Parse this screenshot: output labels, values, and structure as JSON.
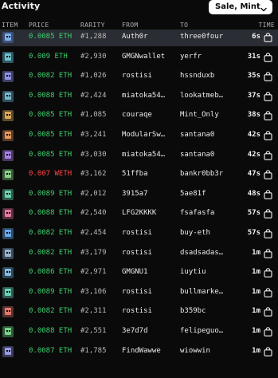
{
  "panel": {
    "title": "Activity",
    "filter_label": "Sale, Mint",
    "filter_icon": "chevron-down-icon"
  },
  "columns": {
    "item": "ITEM",
    "price": "PRICE",
    "rarity": "RARITY",
    "from": "FROM",
    "to": "TO",
    "time": "TIME"
  },
  "colors": {
    "background": "#0a0a0a",
    "highlight_row": "#2a2d33",
    "price_green": "#3ecf6e",
    "price_red": "#ff4545"
  },
  "rows": [
    {
      "price": "0.0085 ETH",
      "rarity": "#1,288",
      "from": "Auth0r",
      "to": "three0four",
      "time": "6s",
      "price_color": "green",
      "thumb_bg": "#3b4f7a",
      "thumb_face": "#7fb0e8",
      "highlight": true,
      "cart_icon": "shopping-bag-icon"
    },
    {
      "price": "0.009 ETH",
      "rarity": "#2,930",
      "from": "GMGNwallet",
      "to": "yerfr",
      "time": "31s",
      "price_color": "green",
      "thumb_bg": "#2f5a6a",
      "thumb_face": "#6fc2c9",
      "highlight": false,
      "cart_icon": "shopping-bag-icon"
    },
    {
      "price": "0.0082 ETH",
      "rarity": "#1,026",
      "from": "rostisi",
      "to": "hssnduxb",
      "time": "35s",
      "price_color": "green",
      "thumb_bg": "#3d3f66",
      "thumb_face": "#8e94e0",
      "highlight": false,
      "cart_icon": "shopping-bag-icon"
    },
    {
      "price": "0.0088 ETH",
      "rarity": "#2,424",
      "from": "miatoka54…",
      "to": "lookatmeb…",
      "time": "37s",
      "price_color": "green",
      "thumb_bg": "#2f4f5e",
      "thumb_face": "#78b6c8",
      "highlight": false,
      "cart_icon": "shopping-bag-icon"
    },
    {
      "price": "0.0085 ETH",
      "rarity": "#1,085",
      "from": "couraqe",
      "to": "Mint_Only",
      "time": "38s",
      "price_color": "green",
      "thumb_bg": "#5e4a2c",
      "thumb_face": "#d8a85c",
      "highlight": false,
      "cart_icon": "shopping-bag-icon"
    },
    {
      "price": "0.0085 ETH",
      "rarity": "#3,241",
      "from": "ModularSw…",
      "to": "santana0",
      "time": "42s",
      "price_color": "green",
      "thumb_bg": "#5a3a2a",
      "thumb_face": "#e09a5a",
      "highlight": false,
      "cart_icon": "shopping-bag-icon"
    },
    {
      "price": "0.0085 ETH",
      "rarity": "#3,030",
      "from": "miatoka54…",
      "to": "santana0",
      "time": "42s",
      "price_color": "green",
      "thumb_bg": "#4a3866",
      "thumb_face": "#a782df",
      "highlight": false,
      "cart_icon": "shopping-bag-icon"
    },
    {
      "price": "0.007 WETH",
      "rarity": "#3,162",
      "from": "51ffba",
      "to": "bankr0bb3r",
      "time": "47s",
      "price_color": "red",
      "thumb_bg": "#3a5a3a",
      "thumb_face": "#8ed08a",
      "highlight": false,
      "cart_icon": "shopping-bag-icon"
    },
    {
      "price": "0.0089 ETH",
      "rarity": "#2,012",
      "from": "3915a7",
      "to": "5ae81f",
      "time": "48s",
      "price_color": "green",
      "thumb_bg": "#2c5a4c",
      "thumb_face": "#6fd0b0",
      "highlight": false,
      "cart_icon": "shopping-bag-icon"
    },
    {
      "price": "0.0088 ETH",
      "rarity": "#2,540",
      "from": "LFG2KKKK",
      "to": "fsafasfa",
      "time": "57s",
      "price_color": "green",
      "thumb_bg": "#5a2f3f",
      "thumb_face": "#e07aa0",
      "highlight": false,
      "cart_icon": "shopping-bag-icon"
    },
    {
      "price": "0.0082 ETH",
      "rarity": "#2,454",
      "from": "rostisi",
      "to": "buy-eth",
      "time": "57s",
      "price_color": "green",
      "thumb_bg": "#2c4a6a",
      "thumb_face": "#6aa8e8",
      "highlight": false,
      "cart_icon": "shopping-bag-icon"
    },
    {
      "price": "0.0082 ETH",
      "rarity": "#3,179",
      "from": "rostisi",
      "to": "dsadsadas…",
      "time": "1m",
      "price_color": "green",
      "thumb_bg": "#3a4a5a",
      "thumb_face": "#9ab4cc",
      "highlight": false,
      "cart_icon": "shopping-bag-icon"
    },
    {
      "price": "0.0086 ETH",
      "rarity": "#2,971",
      "from": "GMGNU1",
      "to": "iuytiu",
      "time": "1m",
      "price_color": "green",
      "thumb_bg": "#2e4458",
      "thumb_face": "#86b8d8",
      "highlight": false,
      "cart_icon": "shopping-bag-icon"
    },
    {
      "price": "0.0089 ETH",
      "rarity": "#3,106",
      "from": "rostisi",
      "to": "bullmarke…",
      "time": "1m",
      "price_color": "green",
      "thumb_bg": "#2f5a52",
      "thumb_face": "#6cd0b8",
      "highlight": false,
      "cart_icon": "shopping-bag-icon"
    },
    {
      "price": "0.0082 ETH",
      "rarity": "#2,311",
      "from": "rostisi",
      "to": "b359bc",
      "time": "1m",
      "price_color": "green",
      "thumb_bg": "#5a3030",
      "thumb_face": "#e07a6a",
      "highlight": false,
      "cart_icon": "shopping-bag-icon"
    },
    {
      "price": "0.0088 ETH",
      "rarity": "#2,551",
      "from": "3e7d7d",
      "to": "felipeguo…",
      "time": "1m",
      "price_color": "green",
      "thumb_bg": "#2f5a3a",
      "thumb_face": "#7ad08a",
      "highlight": false,
      "cart_icon": "shopping-bag-icon"
    },
    {
      "price": "0.0087 ETH",
      "rarity": "#1,785",
      "from": "FindWawwe",
      "to": "wiowwin",
      "time": "1m",
      "price_color": "green",
      "thumb_bg": "#3a3a5a",
      "thumb_face": "#9a9ae0",
      "highlight": false,
      "cart_icon": "shopping-bag-icon"
    }
  ]
}
